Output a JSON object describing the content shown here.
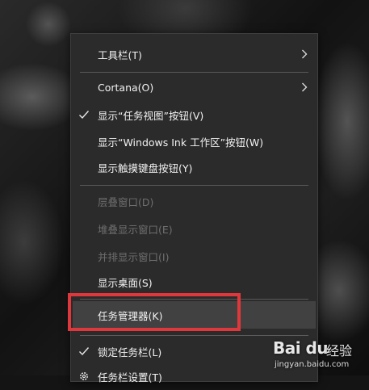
{
  "context_menu": {
    "items": [
      {
        "label": "工具栏(T)",
        "submenu": true
      },
      {
        "label": "Cortana(O)",
        "submenu": true
      },
      {
        "label": "显示“任务视图”按钮(V)",
        "checked": true
      },
      {
        "label": "显示“Windows Ink 工作区”按钮(W)"
      },
      {
        "label": "显示触摸键盘按钮(Y)"
      },
      {
        "label": "层叠窗口(D)",
        "disabled": true
      },
      {
        "label": "堆叠显示窗口(E)",
        "disabled": true
      },
      {
        "label": "并排显示窗口(I)",
        "disabled": true
      },
      {
        "label": "显示桌面(S)"
      },
      {
        "label": "任务管理器(K)",
        "highlighted": true
      },
      {
        "label": "锁定任务栏(L)",
        "checked": true
      },
      {
        "label": "任务栏设置(T)",
        "icon": "gear-icon"
      }
    ]
  },
  "annotation": {
    "color": "#e0373c"
  },
  "watermark": {
    "logo": "Bai du",
    "brand": "经验",
    "url": "jingyan.baidu.com"
  },
  "colors": {
    "menu_bg": "#2b2b2b",
    "text": "#f2f2f2",
    "disabled_text": "#6e6e6e",
    "highlight": "#414141"
  }
}
